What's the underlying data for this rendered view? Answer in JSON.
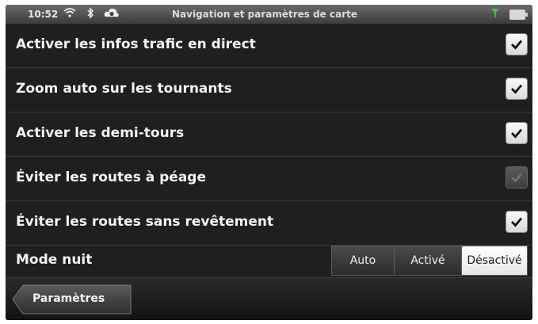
{
  "status_bar": {
    "time": "10:52",
    "title": "Navigation et paramètres de carte",
    "icons": [
      "wifi-icon",
      "bluetooth-icon",
      "sync-icon",
      "signal-icon",
      "battery-icon"
    ]
  },
  "settings": [
    {
      "label": "Activer les infos trafic en direct",
      "checked": true,
      "enabled": true
    },
    {
      "label": "Zoom auto sur les tournants",
      "checked": true,
      "enabled": true
    },
    {
      "label": "Activer les demi-tours",
      "checked": true,
      "enabled": true
    },
    {
      "label": "Éviter les routes à péage",
      "checked": true,
      "enabled": false
    },
    {
      "label": "Éviter les routes sans revêtement",
      "checked": true,
      "enabled": true
    }
  ],
  "night_mode": {
    "label": "Mode nuit",
    "options": [
      "Auto",
      "Activé",
      "Désactivé"
    ],
    "selected": "Désactivé"
  },
  "bottom_bar": {
    "back_label": "Paramètres"
  }
}
